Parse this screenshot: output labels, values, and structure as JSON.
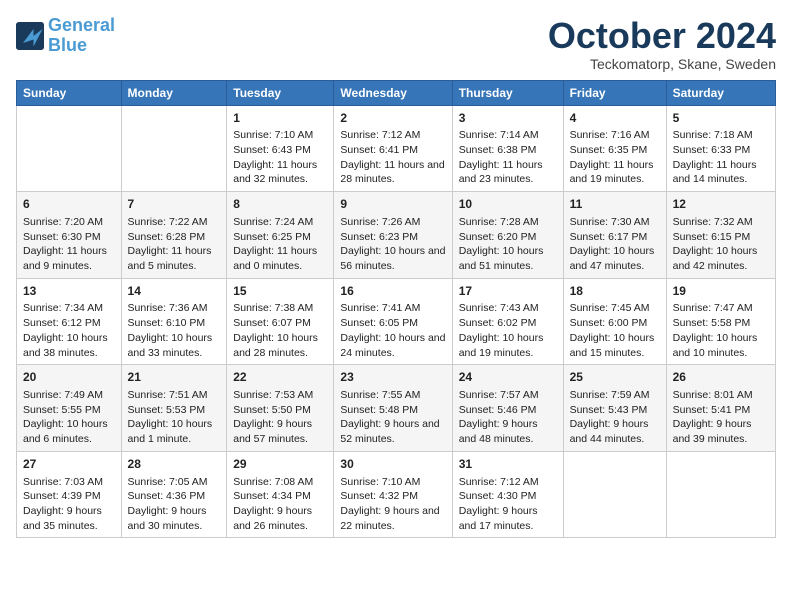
{
  "header": {
    "logo_line1": "General",
    "logo_line2": "Blue",
    "month_title": "October 2024",
    "subtitle": "Teckomatorp, Skane, Sweden"
  },
  "days_of_week": [
    "Sunday",
    "Monday",
    "Tuesday",
    "Wednesday",
    "Thursday",
    "Friday",
    "Saturday"
  ],
  "weeks": [
    [
      {
        "day": "",
        "content": ""
      },
      {
        "day": "",
        "content": ""
      },
      {
        "day": "1",
        "content": "Sunrise: 7:10 AM\nSunset: 6:43 PM\nDaylight: 11 hours and 32 minutes."
      },
      {
        "day": "2",
        "content": "Sunrise: 7:12 AM\nSunset: 6:41 PM\nDaylight: 11 hours and 28 minutes."
      },
      {
        "day": "3",
        "content": "Sunrise: 7:14 AM\nSunset: 6:38 PM\nDaylight: 11 hours and 23 minutes."
      },
      {
        "day": "4",
        "content": "Sunrise: 7:16 AM\nSunset: 6:35 PM\nDaylight: 11 hours and 19 minutes."
      },
      {
        "day": "5",
        "content": "Sunrise: 7:18 AM\nSunset: 6:33 PM\nDaylight: 11 hours and 14 minutes."
      }
    ],
    [
      {
        "day": "6",
        "content": "Sunrise: 7:20 AM\nSunset: 6:30 PM\nDaylight: 11 hours and 9 minutes."
      },
      {
        "day": "7",
        "content": "Sunrise: 7:22 AM\nSunset: 6:28 PM\nDaylight: 11 hours and 5 minutes."
      },
      {
        "day": "8",
        "content": "Sunrise: 7:24 AM\nSunset: 6:25 PM\nDaylight: 11 hours and 0 minutes."
      },
      {
        "day": "9",
        "content": "Sunrise: 7:26 AM\nSunset: 6:23 PM\nDaylight: 10 hours and 56 minutes."
      },
      {
        "day": "10",
        "content": "Sunrise: 7:28 AM\nSunset: 6:20 PM\nDaylight: 10 hours and 51 minutes."
      },
      {
        "day": "11",
        "content": "Sunrise: 7:30 AM\nSunset: 6:17 PM\nDaylight: 10 hours and 47 minutes."
      },
      {
        "day": "12",
        "content": "Sunrise: 7:32 AM\nSunset: 6:15 PM\nDaylight: 10 hours and 42 minutes."
      }
    ],
    [
      {
        "day": "13",
        "content": "Sunrise: 7:34 AM\nSunset: 6:12 PM\nDaylight: 10 hours and 38 minutes."
      },
      {
        "day": "14",
        "content": "Sunrise: 7:36 AM\nSunset: 6:10 PM\nDaylight: 10 hours and 33 minutes."
      },
      {
        "day": "15",
        "content": "Sunrise: 7:38 AM\nSunset: 6:07 PM\nDaylight: 10 hours and 28 minutes."
      },
      {
        "day": "16",
        "content": "Sunrise: 7:41 AM\nSunset: 6:05 PM\nDaylight: 10 hours and 24 minutes."
      },
      {
        "day": "17",
        "content": "Sunrise: 7:43 AM\nSunset: 6:02 PM\nDaylight: 10 hours and 19 minutes."
      },
      {
        "day": "18",
        "content": "Sunrise: 7:45 AM\nSunset: 6:00 PM\nDaylight: 10 hours and 15 minutes."
      },
      {
        "day": "19",
        "content": "Sunrise: 7:47 AM\nSunset: 5:58 PM\nDaylight: 10 hours and 10 minutes."
      }
    ],
    [
      {
        "day": "20",
        "content": "Sunrise: 7:49 AM\nSunset: 5:55 PM\nDaylight: 10 hours and 6 minutes."
      },
      {
        "day": "21",
        "content": "Sunrise: 7:51 AM\nSunset: 5:53 PM\nDaylight: 10 hours and 1 minute."
      },
      {
        "day": "22",
        "content": "Sunrise: 7:53 AM\nSunset: 5:50 PM\nDaylight: 9 hours and 57 minutes."
      },
      {
        "day": "23",
        "content": "Sunrise: 7:55 AM\nSunset: 5:48 PM\nDaylight: 9 hours and 52 minutes."
      },
      {
        "day": "24",
        "content": "Sunrise: 7:57 AM\nSunset: 5:46 PM\nDaylight: 9 hours and 48 minutes."
      },
      {
        "day": "25",
        "content": "Sunrise: 7:59 AM\nSunset: 5:43 PM\nDaylight: 9 hours and 44 minutes."
      },
      {
        "day": "26",
        "content": "Sunrise: 8:01 AM\nSunset: 5:41 PM\nDaylight: 9 hours and 39 minutes."
      }
    ],
    [
      {
        "day": "27",
        "content": "Sunrise: 7:03 AM\nSunset: 4:39 PM\nDaylight: 9 hours and 35 minutes."
      },
      {
        "day": "28",
        "content": "Sunrise: 7:05 AM\nSunset: 4:36 PM\nDaylight: 9 hours and 30 minutes."
      },
      {
        "day": "29",
        "content": "Sunrise: 7:08 AM\nSunset: 4:34 PM\nDaylight: 9 hours and 26 minutes."
      },
      {
        "day": "30",
        "content": "Sunrise: 7:10 AM\nSunset: 4:32 PM\nDaylight: 9 hours and 22 minutes."
      },
      {
        "day": "31",
        "content": "Sunrise: 7:12 AM\nSunset: 4:30 PM\nDaylight: 9 hours and 17 minutes."
      },
      {
        "day": "",
        "content": ""
      },
      {
        "day": "",
        "content": ""
      }
    ]
  ]
}
